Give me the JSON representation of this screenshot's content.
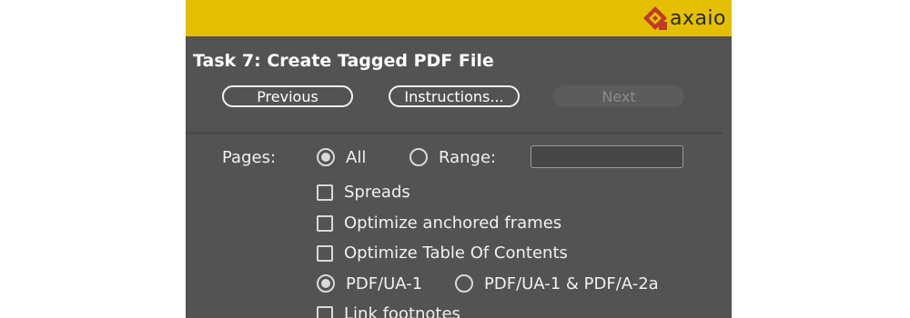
{
  "brand": {
    "name": "axaio",
    "banner_color": "#e4bf00",
    "logo_color": "#c0392b",
    "icon": "axaio-logo-icon"
  },
  "title": "Task 7: Create Tagged PDF File",
  "nav": {
    "previous": "Previous",
    "instructions": "Instructions...",
    "next": "Next",
    "next_enabled": false
  },
  "pages": {
    "label": "Pages:",
    "all_label": "All",
    "all_selected": true,
    "range_label": "Range:",
    "range_value": ""
  },
  "options": {
    "spreads": {
      "label": "Spreads",
      "checked": false
    },
    "optimize_anchored": {
      "label": "Optimize anchored frames",
      "checked": false
    },
    "optimize_toc": {
      "label": "Optimize Table Of Contents",
      "checked": false
    },
    "standard": {
      "ua1": "PDF/UA-1",
      "ua1_a2a": "PDF/UA-1 & PDF/A-2a",
      "selected": "PDF/UA-1"
    },
    "link_footnotes": {
      "label": "Link footnotes",
      "checked": false
    }
  }
}
